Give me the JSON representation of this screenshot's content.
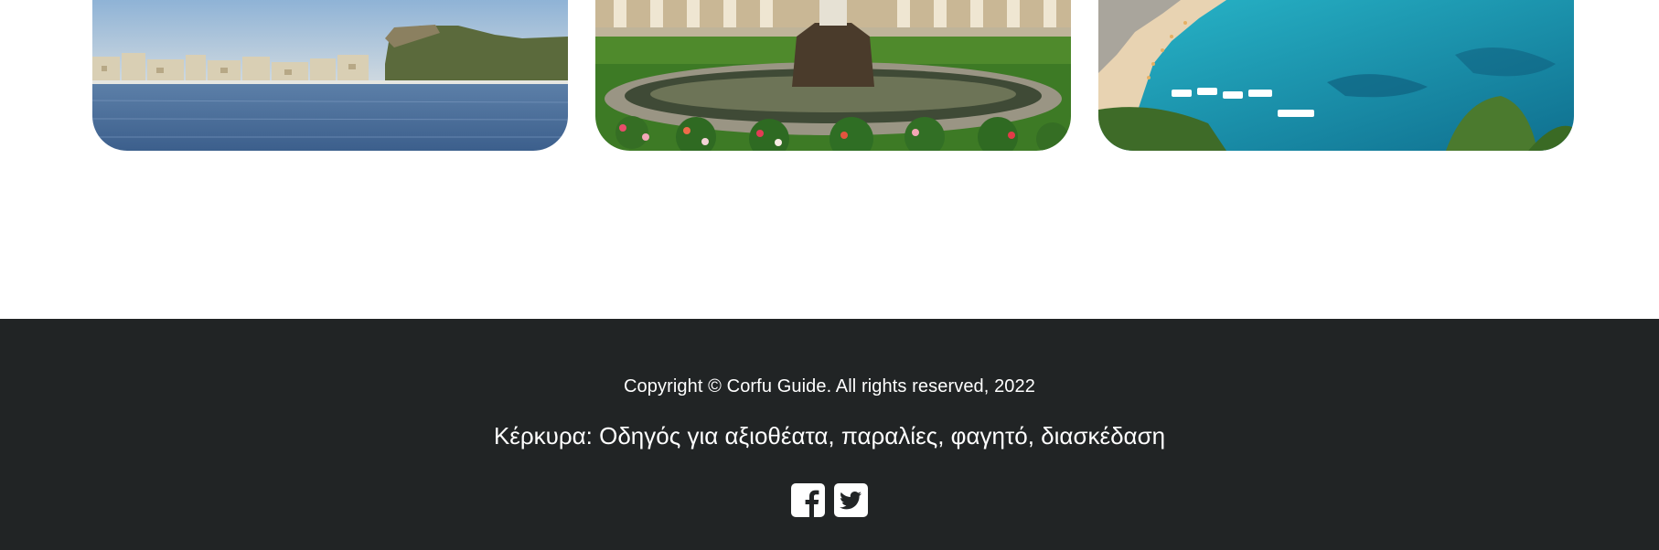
{
  "gallery": {
    "cards": [
      {
        "name": "Corfu town harbour",
        "icon": "photo-old-town-harbour"
      },
      {
        "name": "Garden with fountain and colonnade",
        "icon": "photo-fountain-garden"
      },
      {
        "name": "Turquoise bay with boats",
        "icon": "photo-beach-bay"
      }
    ]
  },
  "footer": {
    "copyright": "Copyright © Corfu Guide. All rights reserved, 2022",
    "tagline": "Κέρκυρα: Οδηγός για αξιοθέατα, παραλίες, φαγητό, διασκέδαση",
    "background_color": "#212425",
    "social": [
      {
        "icon": "facebook-square-icon"
      },
      {
        "icon": "twitter-square-icon"
      }
    ]
  }
}
